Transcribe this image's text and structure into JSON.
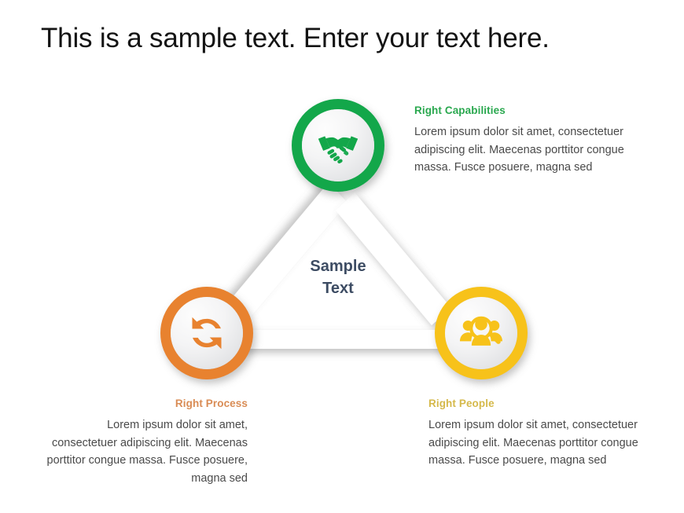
{
  "slide": {
    "title": "This is a sample text. Enter your text here.",
    "background_color": "#ffffff"
  },
  "center": {
    "line1": "Sample",
    "line2": "Text",
    "color": "#3d4c63"
  },
  "nodes": [
    {
      "id": "capabilities",
      "icon": "handshake-icon",
      "color": "#13a74a",
      "position": "top"
    },
    {
      "id": "process",
      "icon": "refresh-cycle-icon",
      "color": "#e8822f",
      "position": "bottom-left"
    },
    {
      "id": "people",
      "icon": "people-search-icon",
      "color": "#f7c21a",
      "position": "bottom-right"
    }
  ],
  "blocks": [
    {
      "id": "capabilities",
      "heading": "Right Capabilities",
      "heading_color": "#2aa84f",
      "body": "Lorem ipsum dolor sit amet, consectetuer adipiscing elit. Maecenas porttitor congue massa. Fusce posuere, magna sed",
      "align": "left"
    },
    {
      "id": "process",
      "heading": "Right Process",
      "heading_color": "#d98c55",
      "body": "Lorem ipsum dolor sit amet, consectetuer adipiscing elit. Maecenas porttitor congue massa. Fusce posuere, magna sed",
      "align": "right"
    },
    {
      "id": "people",
      "heading": "Right People",
      "heading_color": "#d5b94b",
      "body": "Lorem ipsum dolor sit amet, consectetuer adipiscing elit. Maecenas porttitor congue massa. Fusce posuere, magna sed",
      "align": "left"
    }
  ]
}
